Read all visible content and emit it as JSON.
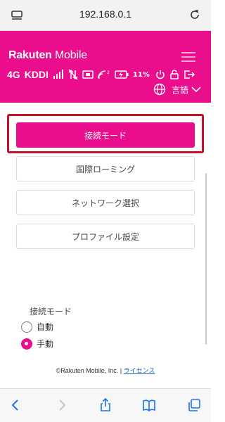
{
  "browser": {
    "url": "192.168.0.1"
  },
  "header": {
    "brand_main": "Rakuten",
    "brand_sub": "Mobile",
    "network_label": "4G",
    "carrier_label": "KDDI",
    "battery_percent": "11%",
    "language_label": "言語"
  },
  "menu": {
    "connection_mode": "接続モード",
    "intl_roaming": "国際ローミング",
    "network_select": "ネットワーク選択",
    "profile_settings": "プロファイル設定"
  },
  "mode": {
    "title": "接続モード",
    "options": [
      {
        "label": "自動",
        "selected": false
      },
      {
        "label": "手動",
        "selected": true
      }
    ]
  },
  "footer": {
    "copyright": "©Rakuten Mobile, Inc. | ",
    "license_link": "ライセンス"
  },
  "colors": {
    "brand_pink": "#ea0d8c",
    "highlight_red": "#c4122a"
  }
}
